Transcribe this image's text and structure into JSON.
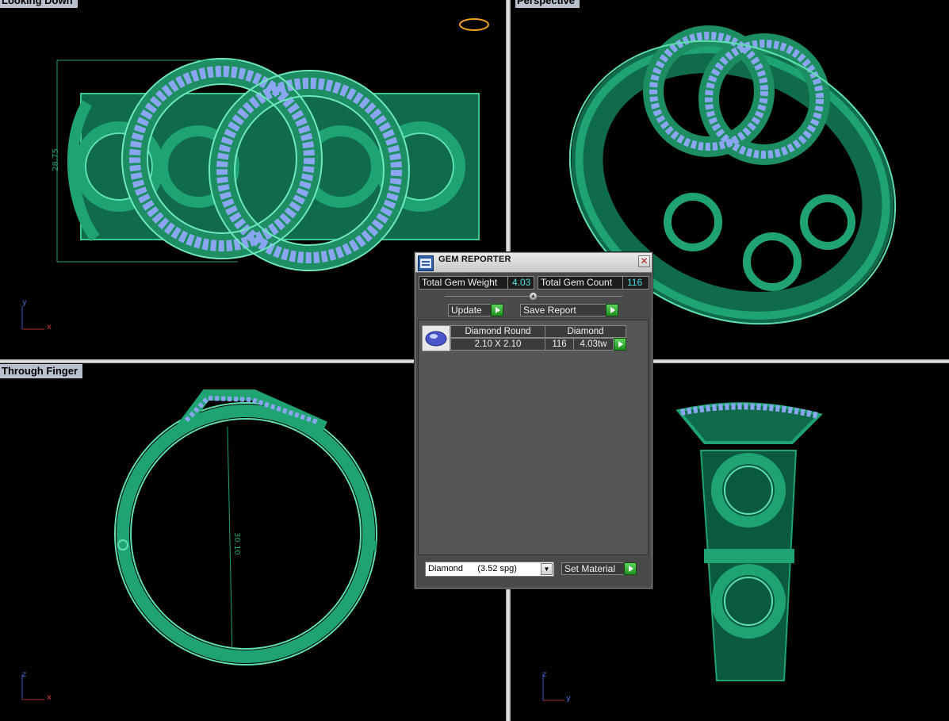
{
  "viewports": {
    "top_left": {
      "label": "Looking Down",
      "dimension": "28.75",
      "axis_v": "y",
      "axis_h": "x"
    },
    "top_right": {
      "label": "Perspective"
    },
    "bottom_left": {
      "label": "Through Finger",
      "dimension": "30.10",
      "axis_v": "z",
      "axis_h": "x"
    },
    "bottom_right": {
      "label": "",
      "axis_v": "z",
      "axis_h": "y"
    }
  },
  "gem_reporter": {
    "title": "GEM REPORTER",
    "total_gem_weight_label": "Total Gem Weight",
    "total_gem_weight_value": "4.03",
    "total_gem_count_label": "Total Gem Count",
    "total_gem_count_value": "116",
    "update_label": "Update",
    "save_report_label": "Save Report",
    "gems": [
      {
        "shape": "Diamond Round",
        "size": "2.10 X 2.10",
        "material": "Diamond",
        "count": "116",
        "weight": "4.03tw"
      }
    ],
    "material_select": "Diamond      (3.52 spg)",
    "set_material_label": "Set Material"
  },
  "colors": {
    "background": "#000000",
    "ring_green": "#1fa372",
    "ring_highlight": "#5fe0b0",
    "gem_blue": "#8aa6f0",
    "panel": "#4a4a4a",
    "value_cyan": "#4fe0e0"
  }
}
